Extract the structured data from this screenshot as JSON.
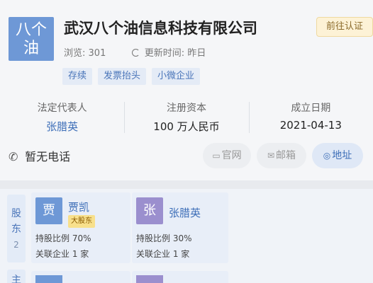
{
  "company": {
    "logo_line1": "八个",
    "logo_line2": "油",
    "name": "武汉八个油信息科技有限公司",
    "auth_button": "前往认证",
    "views_label": "浏览:",
    "views": "301",
    "updated_label": "更新时间:",
    "updated": "昨日",
    "tags": [
      "存续",
      "发票抬头",
      "小微企业"
    ]
  },
  "info": {
    "legal_rep_label": "法定代表人",
    "legal_rep": "张腊英",
    "capital_label": "注册资本",
    "capital": "100 万人民币",
    "founded_label": "成立日期",
    "founded": "2021-04-13"
  },
  "contact": {
    "phone": "暂无电话",
    "website": "官网",
    "email": "邮箱",
    "address": "地址"
  },
  "shareholders": {
    "tab_line1": "股",
    "tab_line2": "东",
    "count": "2",
    "tab2": "主",
    "items": [
      {
        "avatar": "贾",
        "name": "贾凯",
        "badge": "大股东",
        "ratio": "持股比例 70%",
        "related": "关联企业 1 家"
      },
      {
        "avatar": "张",
        "name": "张腊英",
        "ratio": "持股比例 30%",
        "related": "关联企业 1 家"
      }
    ]
  },
  "colors": {
    "accent": "#3e6fb8",
    "logo": "#6e98d6",
    "avatar2": "#9b8fce",
    "badge": "#f8e08c"
  }
}
